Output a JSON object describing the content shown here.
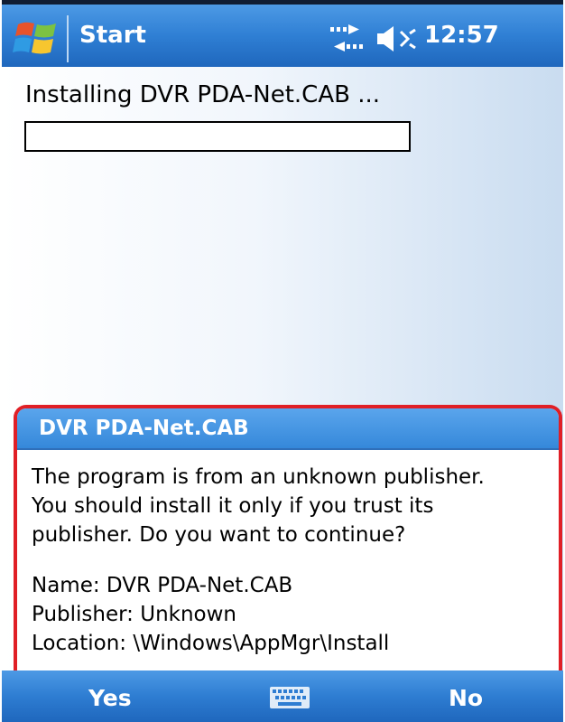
{
  "titlebar": {
    "title": "Start",
    "time": "12:57",
    "icons": [
      "windows-logo",
      "connectivity-arrows-icon",
      "speaker-icon"
    ]
  },
  "install": {
    "status_text": "Installing DVR PDA-Net.CAB ...",
    "progress_fraction": 0
  },
  "dialog": {
    "title": "DVR PDA-Net.CAB",
    "message_lines": [
      "The program is from an unknown publisher.",
      "You should install it only if you trust its",
      "publisher. Do you want to continue?"
    ],
    "details": [
      "Name: DVR PDA-Net.CAB",
      "Publisher: Unknown",
      "Location: \\Windows\\AppMgr\\Install"
    ]
  },
  "softkeys": {
    "left": "Yes",
    "right": "No",
    "center_icon": "keyboard-icon"
  },
  "colors": {
    "bar_blue": "#2f7fd4",
    "dialog_border": "#e01f26"
  }
}
